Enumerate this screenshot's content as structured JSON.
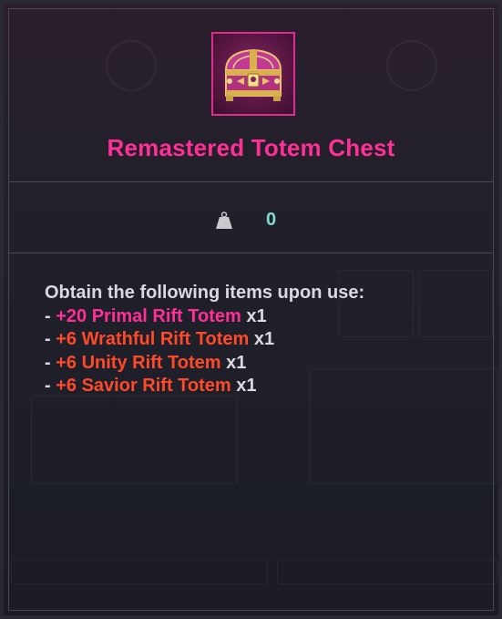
{
  "item": {
    "name": "Remastered Totem Chest",
    "icon": "treasure-chest-icon",
    "rarity_color": "#ff2f98",
    "weight_icon": "weight-icon",
    "weight": "0"
  },
  "description": {
    "intro": "Obtain the following items upon use:",
    "entries": [
      {
        "bullet": "- ",
        "name": "+20 Primal Rift Totem",
        "qty": " x1",
        "color": "#ff2f98"
      },
      {
        "bullet": "- ",
        "name": "+6 Wrathful Rift Totem",
        "qty": " x1",
        "color": "#ff4a2a"
      },
      {
        "bullet": "- ",
        "name": "+6 Unity Rift Totem",
        "qty": " x1",
        "color": "#ff4a2a"
      },
      {
        "bullet": "- ",
        "name": "+6 Savior Rift Totem",
        "qty": " x1",
        "color": "#ff4a2a"
      }
    ]
  }
}
